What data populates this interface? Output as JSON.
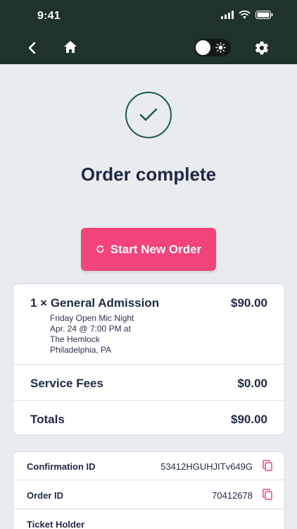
{
  "status_bar": {
    "time": "9:41"
  },
  "nav": {
    "back_icon": "chevron-left-icon",
    "home_icon": "home-icon",
    "theme_toggle_icon": "sun-icon",
    "settings_icon": "gear-icon"
  },
  "confirmation": {
    "icon": "check-icon",
    "title": "Order complete",
    "button_label": "Start New Order",
    "button_icon": "refresh-icon"
  },
  "order": {
    "item_title": "1 × General Admission",
    "item_price": "$90.00",
    "item_details": [
      "Friday Open Mic Night",
      "Apr. 24 @ 7:00 PM at",
      "The Hemlock",
      "Philadelphia, PA"
    ],
    "service_fees_label": "Service Fees",
    "service_fees_value": "$0.00",
    "totals_label": "Totals",
    "totals_value": "$90.00"
  },
  "info": {
    "confirmation_id_label": "Confirmation ID",
    "confirmation_id_value": "53412HGUHJITv649G",
    "order_id_label": "Order ID",
    "order_id_value": "70412678",
    "ticket_holder_label": "Ticket Holder"
  },
  "colors": {
    "header_bg": "#1f322d",
    "accent_pink": "#f2447b",
    "check_green": "#1f5b45",
    "page_bg": "#e9ecef"
  }
}
